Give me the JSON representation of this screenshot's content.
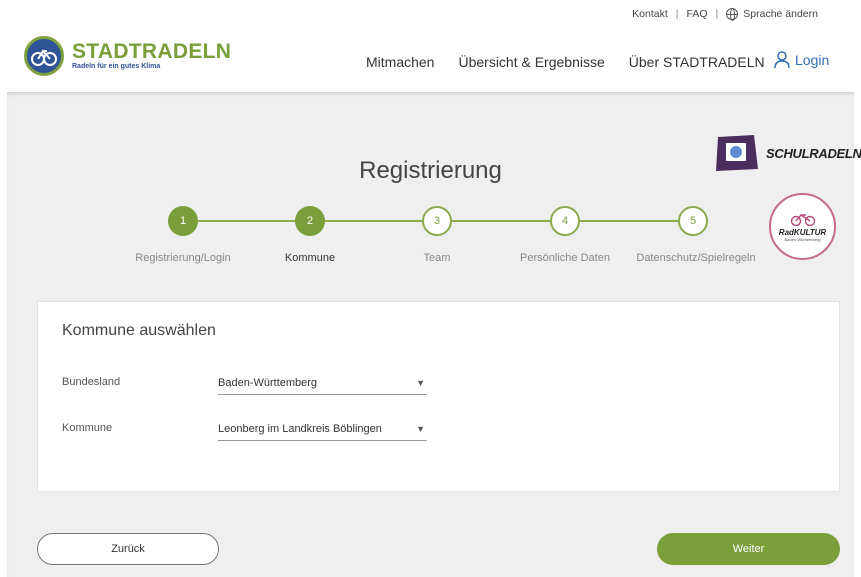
{
  "topbar": {
    "contact": "Kontakt",
    "faq": "FAQ",
    "language": "Sprache ändern",
    "separator": "|"
  },
  "brand": {
    "title": "STADTRADELN",
    "subtitle": "Radeln für ein gutes Klima"
  },
  "nav": {
    "items": [
      "Mitmachen",
      "Übersicht & Ergebnisse",
      "Über STADTRADELN"
    ],
    "login": "Login"
  },
  "partners": {
    "schulradeln": "SCHULRADELN",
    "radkultur": "RadKULTUR",
    "radkultur_sub": "Baden-Württemberg"
  },
  "page": {
    "title": "Registrierung"
  },
  "steps": [
    {
      "number": "1",
      "label": "Registrierung/Login",
      "state": "done"
    },
    {
      "number": "2",
      "label": "Kommune",
      "state": "active"
    },
    {
      "number": "3",
      "label": "Team",
      "state": "todo"
    },
    {
      "number": "4",
      "label": "Persönliche Daten",
      "state": "todo"
    },
    {
      "number": "5",
      "label": "Datenschutz/Spielregeln",
      "state": "todo"
    }
  ],
  "form": {
    "heading": "Kommune auswählen",
    "bundesland_label": "Bundesland",
    "bundesland_value": "Baden-Württemberg",
    "kommune_label": "Kommune",
    "kommune_value": "Leonberg im Landkreis Böblingen"
  },
  "buttons": {
    "back": "Zurück",
    "next": "Weiter"
  },
  "colors": {
    "accent_green": "#7a9e3a",
    "brand_blue": "#2f5597",
    "link_blue": "#2f6eb5"
  }
}
